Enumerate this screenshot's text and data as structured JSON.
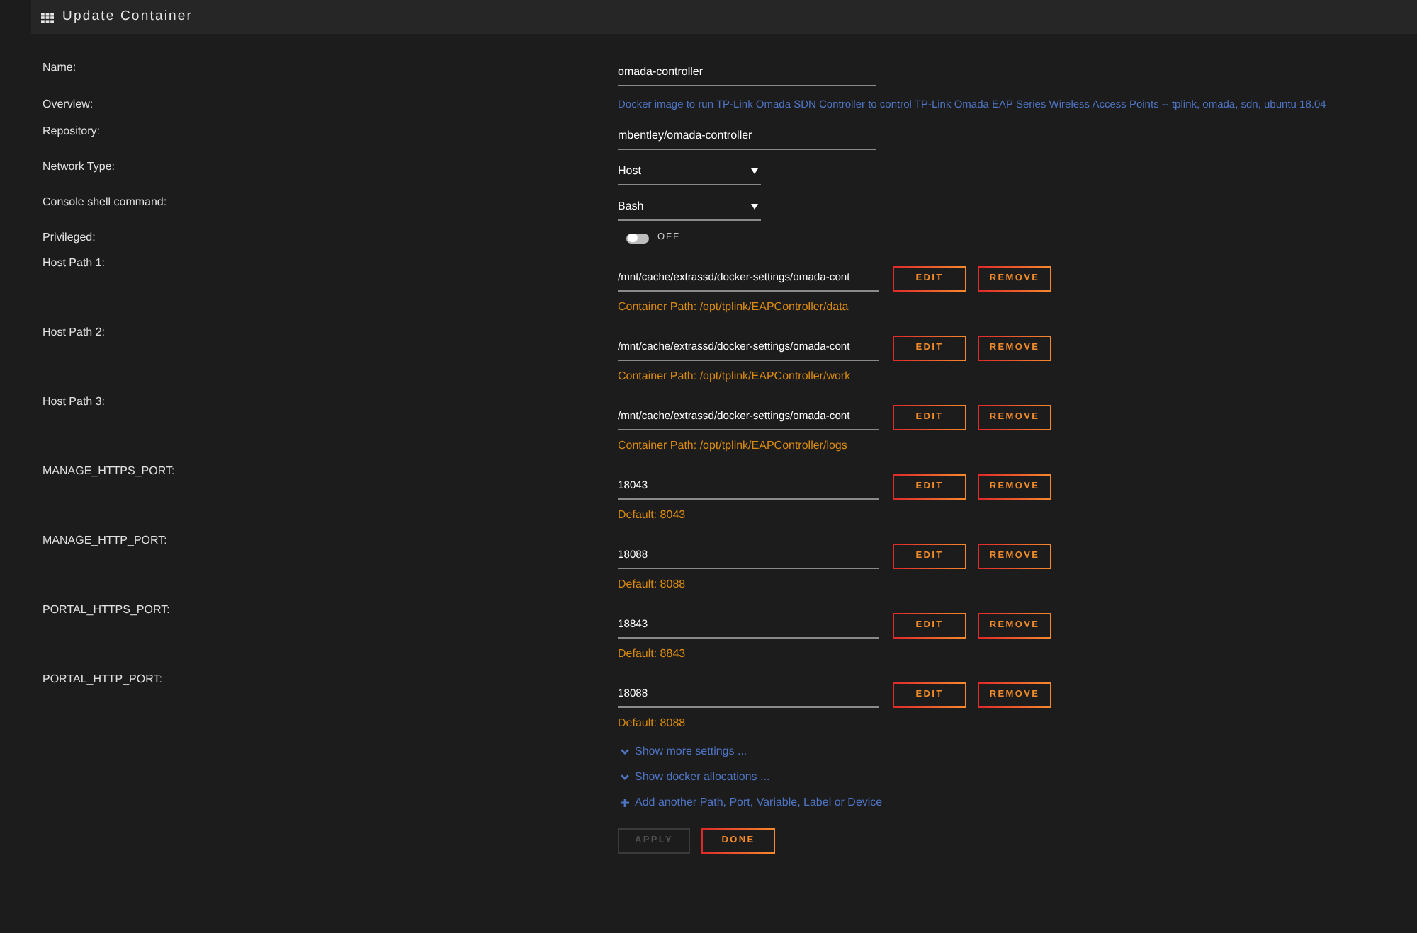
{
  "header": {
    "title": "Update Container"
  },
  "fields": [
    {
      "kind": "text",
      "label": "Name:",
      "value": "omada-controller"
    },
    {
      "kind": "description",
      "label": "Overview:",
      "value": "Docker image to run TP-Link Omada SDN Controller to control TP-Link Omada EAP Series Wireless Access Points -- tplink, omada, sdn, ubuntu 18.04"
    },
    {
      "kind": "text",
      "label": "Repository:",
      "value": "mbentley/omada-controller"
    },
    {
      "kind": "select",
      "label": "Network Type:",
      "value": "Host"
    },
    {
      "kind": "select",
      "label": "Console shell command:",
      "value": "Bash"
    },
    {
      "kind": "toggle",
      "label": "Privileged:",
      "on": false,
      "state_label": "OFF"
    }
  ],
  "mappings": [
    {
      "label": "Host Path 1:",
      "value": "/mnt/cache/extrassd/docker-settings/omada-cont",
      "note": "Container Path: /opt/tplink/EAPController/data",
      "edit_label": "EDIT",
      "remove_label": "REMOVE"
    },
    {
      "label": "Host Path 2:",
      "value": "/mnt/cache/extrassd/docker-settings/omada-cont",
      "note": "Container Path: /opt/tplink/EAPController/work",
      "edit_label": "EDIT",
      "remove_label": "REMOVE"
    },
    {
      "label": "Host Path 3:",
      "value": "/mnt/cache/extrassd/docker-settings/omada-cont",
      "note": "Container Path: /opt/tplink/EAPController/logs",
      "edit_label": "EDIT",
      "remove_label": "REMOVE"
    },
    {
      "label": "MANAGE_HTTPS_PORT:",
      "value": "18043",
      "note": "Default: 8043",
      "edit_label": "EDIT",
      "remove_label": "REMOVE"
    },
    {
      "label": "MANAGE_HTTP_PORT:",
      "value": "18088",
      "note": "Default: 8088",
      "edit_label": "EDIT",
      "remove_label": "REMOVE"
    },
    {
      "label": "PORTAL_HTTPS_PORT:",
      "value": "18843",
      "note": "Default: 8843",
      "edit_label": "EDIT",
      "remove_label": "REMOVE"
    },
    {
      "label": "PORTAL_HTTP_PORT:",
      "value": "18088",
      "note": "Default: 8088",
      "edit_label": "EDIT",
      "remove_label": "REMOVE"
    }
  ],
  "links": [
    {
      "kind": "expand",
      "text": "Show more settings ..."
    },
    {
      "kind": "expand",
      "text": "Show docker allocations ..."
    },
    {
      "kind": "add",
      "text": "Add another Path, Port, Variable, Label or Device"
    }
  ],
  "actions": [
    {
      "label": "APPLY",
      "disabled": true
    },
    {
      "label": "DONE",
      "disabled": false
    }
  ]
}
